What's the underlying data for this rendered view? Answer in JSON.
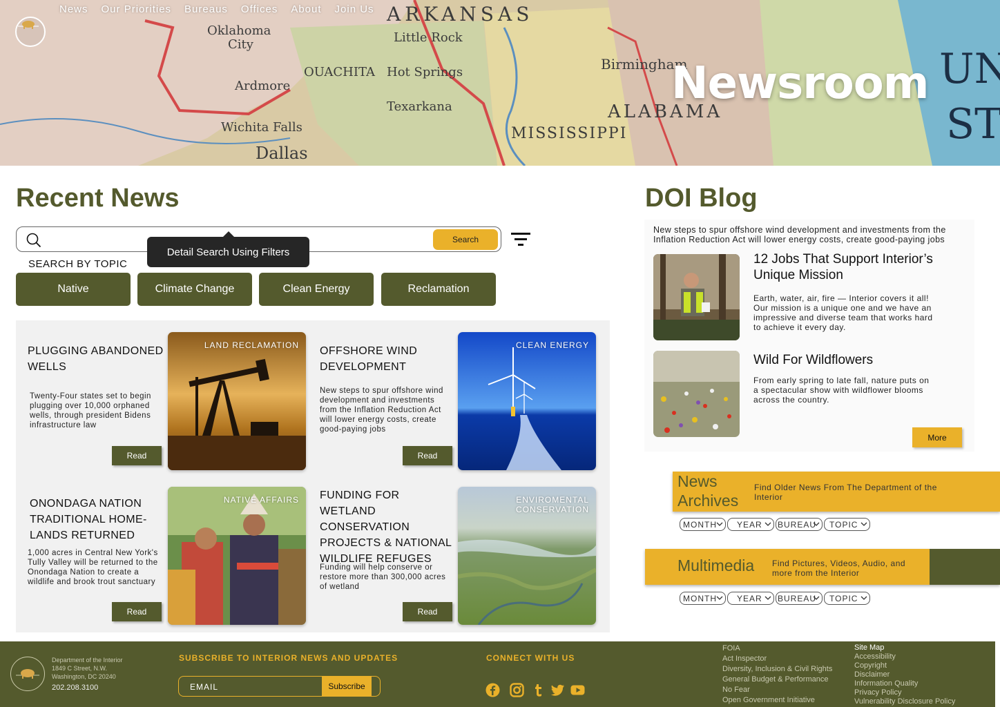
{
  "nav": {
    "items": [
      "News",
      "Our Priorities",
      "Bureaus",
      "Offices",
      "About",
      "Join Us"
    ]
  },
  "hero": {
    "title": "Newsroom"
  },
  "recent_news": {
    "title": "Recent News",
    "search_button": "Search",
    "tooltip": "Detail Search Using Filters",
    "topic_label": "SEARCH BY TOPIC",
    "topics": [
      "Native",
      "Climate Change",
      "Clean Energy",
      "Reclamation"
    ],
    "cards": [
      {
        "title": "PLUGGING ABANDONED WELLS",
        "text": "Twenty-Four states set to begin plugging over 10,000 orphaned wells, through president Bidens infrastructure law",
        "button": "Read",
        "tag": "LAND RECLAMATION"
      },
      {
        "title": "OFFSHORE WIND DEVELOPMENT",
        "text": "New steps to spur offshore wind development and investments from the Inflation Reduction Act will lower energy costs, create good-paying jobs",
        "button": "Read",
        "tag": "CLEAN ENERGY"
      },
      {
        "title": "ONONDAGA NATION TRADITIONAL HOME-LANDS RETURNED",
        "text": "1,000 acres in Central New York's Tully Valley will be returned to the Onondaga Nation to create a wildlife and brook trout sanctuary",
        "button": "Read",
        "tag": "NATIVE AFFAIRS"
      },
      {
        "title": "FUNDING FOR WETLAND CONSERVATION PROJECTS & NATIONAL WILDLIFE REFUGES",
        "text": "Funding will help conserve or restore more than 300,000 acres of wetland",
        "button": "Read",
        "tag": "ENVIROMENTAL CONSERVATION"
      }
    ]
  },
  "blog": {
    "title": "DOI Blog",
    "intro": "New steps to spur offshore wind development and investments from the Inflation Reduction Act will lower energy costs, create good-paying jobs",
    "posts": [
      {
        "title": "12 Jobs That Support Interior’s Unique Mission",
        "text": "Earth, water, air, fire — Interior covers it all! Our mission is a unique one and we have an impressive and diverse team that works hard to achieve it every day."
      },
      {
        "title": "Wild For Wildflowers",
        "text": "From early spring to late fall, nature puts on a spectacular show with wildflower blooms across the country."
      }
    ],
    "more_button": "More"
  },
  "archives": {
    "title": "News Archives",
    "desc": "Find Older News From The Department of the Interior",
    "filters": [
      "MONTH",
      "YEAR",
      "BUREAU",
      "TOPIC"
    ]
  },
  "multimedia": {
    "title": "Multimedia",
    "desc": "Find Pictures, Videos, Audio, and more from the Interior",
    "filters": [
      "MONTH",
      "YEAR",
      "BUREAU",
      "TOPIC"
    ]
  },
  "footer": {
    "org": "Department of the Interior",
    "street": "1849 C Street, N.W.",
    "city": "Washington, DC 20240",
    "phone": "202.208.3100",
    "subscribe_heading": "SUBSCRIBE TO INTERIOR NEWS AND UPDATES",
    "email_label": "EMAIL",
    "subscribe_button": "Subscribe",
    "connect_heading": "CONNECT WITH US",
    "links_col1": [
      "FOIA",
      "Act Inspector",
      "Diversity, Inclusion & Civil Rights",
      "General Budget & Performance",
      "No Fear",
      "Open Government Initiative"
    ],
    "links_col2": [
      "Site Map",
      "Accessibility",
      "Copyright",
      "Disclaimer",
      "Information Quality",
      "Privacy Policy",
      "Vulnerability Disclosure Policy"
    ]
  },
  "colors": {
    "olive": "#545a2d",
    "gold": "#eab12a",
    "tooltip": "#262626"
  }
}
